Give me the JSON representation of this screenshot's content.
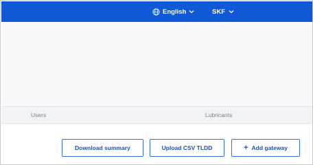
{
  "header": {
    "language": {
      "label": "English",
      "icon": "globe-icon"
    },
    "company": {
      "label": "SKF"
    }
  },
  "tabs": [
    {
      "label": "Users"
    },
    {
      "label": "Lubricants"
    }
  ],
  "actions": {
    "download_summary": "Download summary",
    "upload_csv": "Upload CSV TLDD",
    "add_gateway": "Add gateway",
    "add_icon": "+"
  },
  "colors": {
    "header_bg": "#0f58d6",
    "accent": "#2f6fe0"
  }
}
